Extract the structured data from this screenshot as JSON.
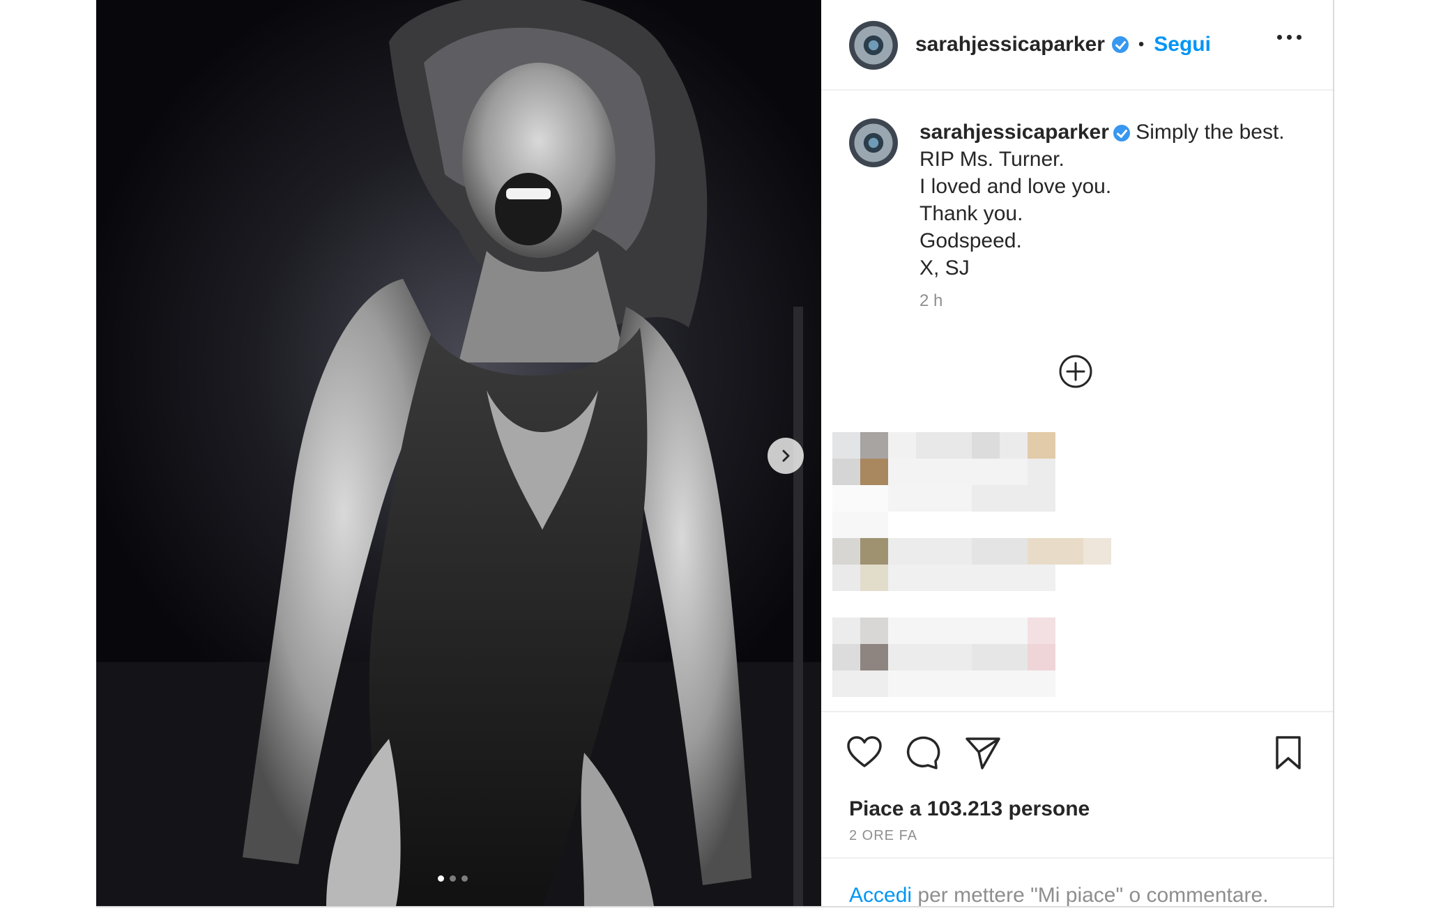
{
  "post": {
    "username": "sarahjessicaparker",
    "follow_label": "Segui",
    "separator": "•",
    "caption": {
      "first_line": "Simply the best.",
      "lines": [
        "RIP Ms. Turner.",
        "I loved and love you.",
        "Thank you.",
        "Godspeed.",
        "X, SJ"
      ]
    },
    "time_ago": "2 h",
    "likes_text": "Piace a 103.213 persone",
    "posted_ago": "2 ORE FA",
    "login": {
      "link": "Accedi",
      "rest": " per mettere \"Mi piace\" o commentare."
    },
    "carousel": {
      "count": 3,
      "active_index": 0
    }
  },
  "icons": {
    "verified": "verified-badge-icon",
    "more": "more-options-icon",
    "add": "add-circle-icon",
    "like": "heart-icon",
    "comment": "comment-icon",
    "share": "paper-plane-icon",
    "save": "bookmark-icon",
    "next": "chevron-right-icon"
  },
  "colors": {
    "link": "#0095f6",
    "verified": "#3897f0",
    "secondary_text": "#8e8e8e",
    "primary_text": "#262626"
  }
}
